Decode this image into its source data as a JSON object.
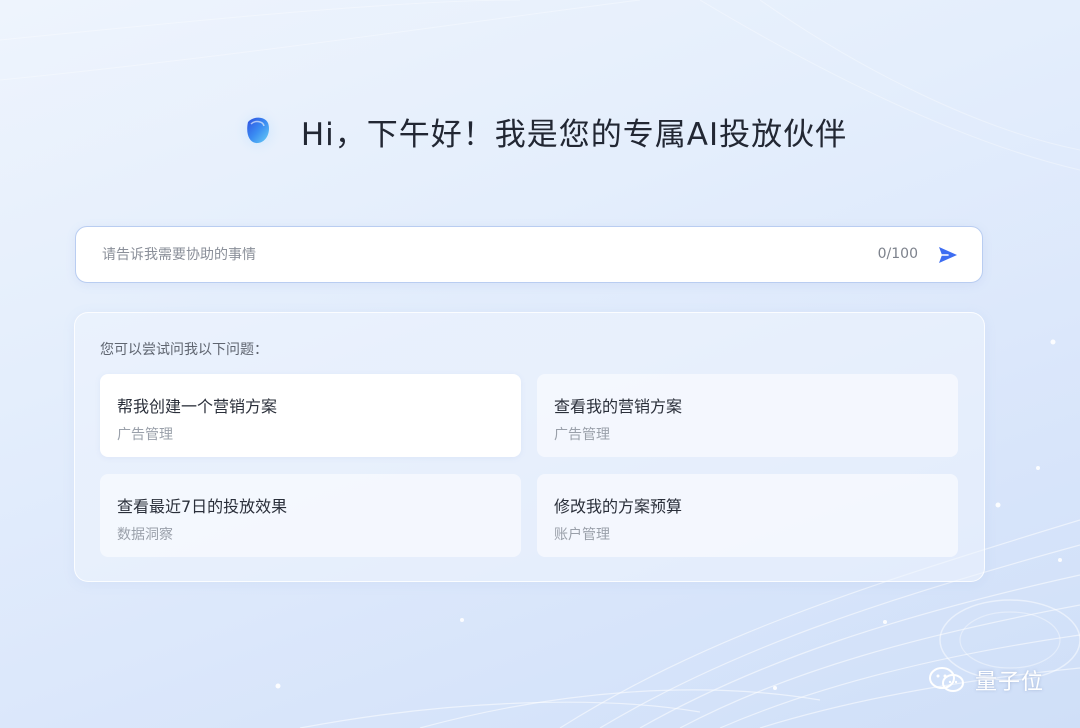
{
  "header": {
    "title": "Hi，下午好！我是您的专属AI投放伙伴",
    "logo_icon": "ai-assistant-logo-icon"
  },
  "search": {
    "placeholder": "请告诉我需要协助的事情",
    "value": "",
    "counter": "0/100",
    "send_icon": "send-icon"
  },
  "suggestions": {
    "title": "您可以尝试问我以下问题：",
    "items": [
      {
        "title": "帮我创建一个营销方案",
        "category": "广告管理"
      },
      {
        "title": "查看我的营销方案",
        "category": "广告管理"
      },
      {
        "title": "查看最近7日的投放效果",
        "category": "数据洞察"
      },
      {
        "title": "修改我的方案预算",
        "category": "账户管理"
      }
    ]
  },
  "watermark": {
    "text": "量子位",
    "icon": "wechat-icon"
  },
  "colors": {
    "accent": "#3d6df2",
    "background": "#e4eefc",
    "text_primary": "#222733",
    "text_secondary": "#9aa0aa"
  }
}
